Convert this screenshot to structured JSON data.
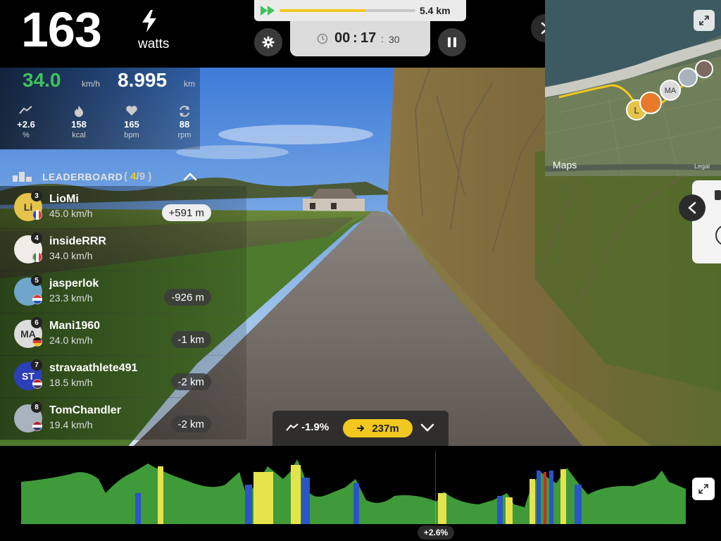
{
  "power": {
    "value": "163",
    "unit": "watts"
  },
  "progress": {
    "distance_remaining": "5.4 km",
    "fraction": 0.63
  },
  "timer": {
    "minutes": "00",
    "sep": ":",
    "seconds": "17",
    "sep2": ":",
    "centis": "30"
  },
  "stats": {
    "speed": {
      "value": "34.0",
      "unit": "km/h",
      "color": "#3fc35b"
    },
    "distance": {
      "value": "8.995",
      "unit": "km"
    },
    "grade": {
      "value": "+2.6",
      "unit": "%",
      "icon": "incline-icon"
    },
    "kcal": {
      "value": "158",
      "unit": "kcal",
      "icon": "flame-icon"
    },
    "bpm": {
      "value": "165",
      "unit": "bpm",
      "icon": "heart-icon"
    },
    "rpm": {
      "value": "88",
      "unit": "rpm",
      "icon": "cadence-icon"
    }
  },
  "leaderboard": {
    "title": "LEADERBOARD",
    "count_open": "(",
    "position": "4",
    "slash": "/",
    "total": "9",
    "count_close": ")",
    "riders": [
      {
        "rank": "3",
        "avatar": "Li",
        "name": "LioMi",
        "speed": "45.0 km/h",
        "gap": "+591 m",
        "gap_style": "light",
        "flag": "fr",
        "avatar_color": "#e6c34a"
      },
      {
        "rank": "4",
        "avatar": "",
        "name": "insideRRR",
        "speed": "34.0 km/h",
        "gap": "",
        "gap_style": "",
        "flag": "it",
        "avatar_color": "#f0ede8"
      },
      {
        "rank": "5",
        "avatar": "",
        "name": "jasperlok",
        "speed": "23.3 km/h",
        "gap": "-926 m",
        "gap_style": "dark",
        "flag": "nl",
        "avatar_color": "#6fa6c9"
      },
      {
        "rank": "6",
        "avatar": "MA",
        "name": "Mani1960",
        "speed": "24.0 km/h",
        "gap": "-1 km",
        "gap_style": "dark",
        "flag": "de",
        "avatar_color": "#dcdcdc"
      },
      {
        "rank": "7",
        "avatar": "ST",
        "name": "stravaathlete491",
        "speed": "18.5 km/h",
        "gap": "-2 km",
        "gap_style": "dark",
        "flag": "us",
        "avatar_color": "#2b3fb8"
      },
      {
        "rank": "8",
        "avatar": "",
        "name": "TomChandler",
        "speed": "19.4 km/h",
        "gap": "-2 km",
        "gap_style": "dark",
        "flag": "us",
        "avatar_color": "#a9b3bd"
      }
    ]
  },
  "map": {
    "attribution": "Maps",
    "legal": "Legal",
    "markers": [
      "L",
      "MA"
    ]
  },
  "grade_panel": {
    "grade": "-1.9%",
    "distance": "237m"
  },
  "profile": {
    "current_grade": "+2.6%"
  },
  "colors": {
    "accent_yellow": "#f2c71f",
    "profile_green": "#3f9a3a",
    "profile_blue": "#2a55c6",
    "profile_red": "#d02a2a"
  }
}
